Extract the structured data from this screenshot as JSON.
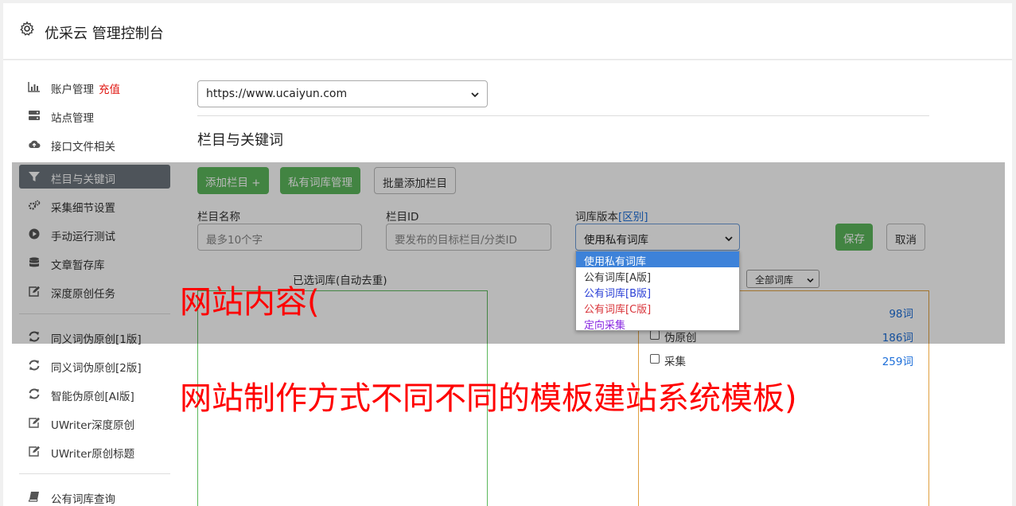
{
  "header": {
    "title": "优采云 管理控制台",
    "icon": "gear-icon"
  },
  "sidebar": {
    "items": [
      {
        "label": "账户管理",
        "icon": "bar-chart-icon",
        "badge": "充值"
      },
      {
        "label": "站点管理",
        "icon": "server-icon"
      },
      {
        "label": "接口文件相关",
        "icon": "cloud-upload-icon"
      },
      {
        "label": "栏目与关键词",
        "icon": "filter-icon",
        "active": true
      },
      {
        "label": "采集细节设置",
        "icon": "gears-icon"
      },
      {
        "label": "手动运行测试",
        "icon": "play-circle-icon"
      },
      {
        "label": "文章暂存库",
        "icon": "database-icon"
      },
      {
        "label": "深度原创任务",
        "icon": "edit-icon"
      },
      {
        "label": "同义词伪原创[1版]",
        "icon": "refresh-icon"
      },
      {
        "label": "同义词伪原创[2版]",
        "icon": "refresh-icon"
      },
      {
        "label": "智能伪原创[AI版]",
        "icon": "refresh-icon"
      },
      {
        "label": "UWriter深度原创",
        "icon": "edit-icon"
      },
      {
        "label": "UWriter原创标题",
        "icon": "edit-icon"
      },
      {
        "label": "公有词库查询",
        "icon": "book-icon"
      }
    ]
  },
  "main": {
    "site_select": "https://www.ucaiyun.com",
    "section_title": "栏目与关键词",
    "buttons": {
      "add_column": "添加栏目 +",
      "private_lib": "私有词库管理",
      "batch_add": "批量添加栏目",
      "save": "保存",
      "cancel": "取消"
    },
    "form": {
      "name_label": "栏目名称",
      "name_placeholder": "最多10个字",
      "id_label": "栏目ID",
      "id_placeholder": "要发布的目标栏目/分类ID",
      "version_label": "词库版本",
      "version_link": "[区别]",
      "version_value": "使用私有词库"
    },
    "version_options": [
      {
        "label": "使用私有词库",
        "color": "#ffffff",
        "selected": true
      },
      {
        "label": "公有词库[A版]",
        "color": "#333333"
      },
      {
        "label": "公有词库[B版]",
        "color": "#2a3fd6"
      },
      {
        "label": "公有词库[C版]",
        "color": "#d9343a"
      },
      {
        "label": "定向采集",
        "color": "#8a2be2"
      }
    ],
    "selected_lib_label": "已选词库(自动去重)",
    "lib_filter": "全部词库",
    "libraries": [
      {
        "name": "",
        "count": "98词"
      },
      {
        "name": "伪原创",
        "count": "186词"
      },
      {
        "name": "采集",
        "count": "259词"
      }
    ]
  },
  "watermark": {
    "line1": "网站内容(",
    "line2": "网站制作方式不同不同的模板建站系统模板)",
    "color": "#ff0000"
  }
}
